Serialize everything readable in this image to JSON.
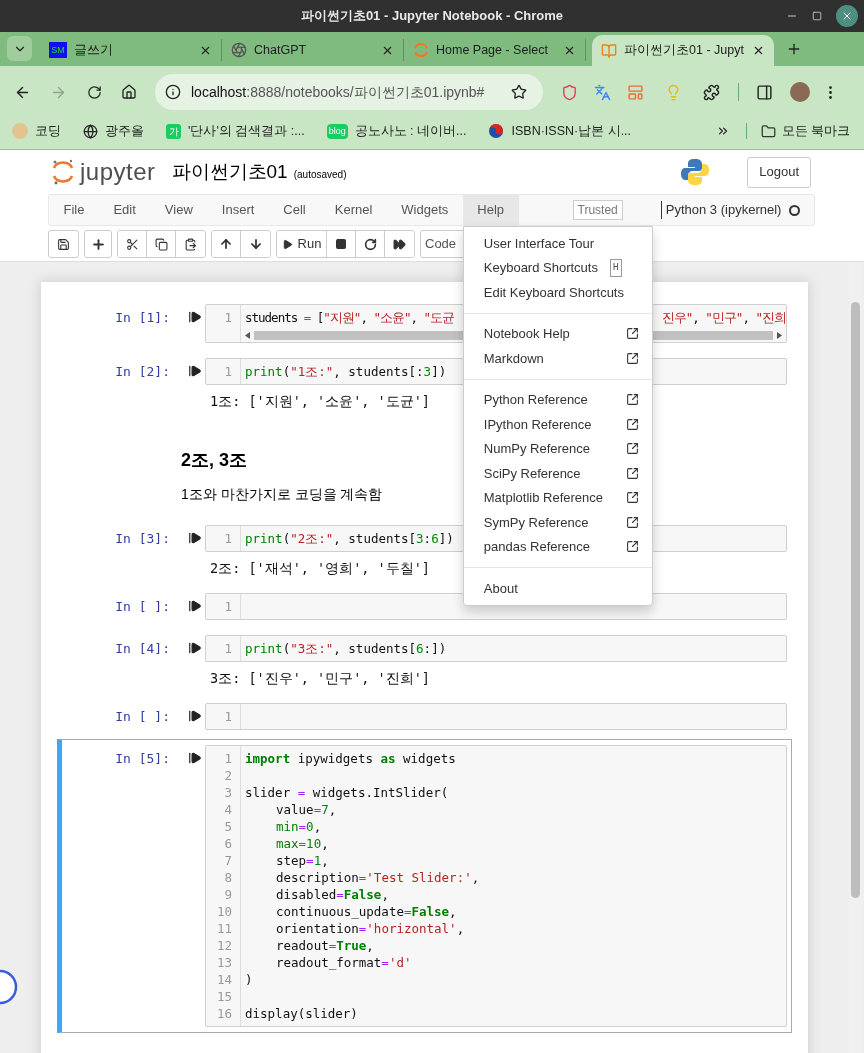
{
  "window": {
    "title": "파이썬기초01 - Jupyter Notebook - Chrome"
  },
  "browser_tabs": [
    {
      "label": "글쓰기",
      "icon_text": "SM",
      "selected": false
    },
    {
      "label": "ChatGPT",
      "selected": false
    },
    {
      "label": "Home Page - Select",
      "selected": false
    },
    {
      "label": "파이썬기초01 - Jupyt",
      "selected": true
    }
  ],
  "address_bar": {
    "host": "localhost",
    "path": ":8888/notebooks/파이썬기초01.ipynb#"
  },
  "bookmarks": [
    {
      "label": "코딩"
    },
    {
      "label": "광주올"
    },
    {
      "label": "'단사'의 검색결과 :...",
      "icon_text": "가"
    },
    {
      "label": "공노사노 : 네이버...",
      "icon_text": "blog"
    },
    {
      "label": "ISBN·ISSN·납본 시..."
    }
  ],
  "bookmarks_folder": "모든 북마크",
  "notebook": {
    "logo_text": "jupyter",
    "title": "파이썬기초01",
    "status": "(autosaved)",
    "logout": "Logout",
    "menu": [
      {
        "label": "File",
        "selected": false
      },
      {
        "label": "Edit",
        "selected": false
      },
      {
        "label": "View",
        "selected": false
      },
      {
        "label": "Insert",
        "selected": false
      },
      {
        "label": "Cell",
        "selected": false
      },
      {
        "label": "Kernel",
        "selected": false
      },
      {
        "label": "Widgets",
        "selected": false
      },
      {
        "label": "Help",
        "selected": true
      }
    ],
    "trusted": "Trusted",
    "kernel": "Python 3 (ipykernel)",
    "run_label": "Run",
    "cell_type": "Code"
  },
  "help_menu": [
    [
      {
        "label": "User Interface Tour",
        "kind": "plain"
      },
      {
        "label": "Keyboard Shortcuts",
        "kind": "shortcut",
        "key": "H"
      },
      {
        "label": "Edit Keyboard Shortcuts",
        "kind": "plain"
      }
    ],
    [
      {
        "label": "Notebook Help",
        "kind": "external"
      },
      {
        "label": "Markdown",
        "kind": "external"
      }
    ],
    [
      {
        "label": "Python Reference",
        "kind": "external"
      },
      {
        "label": "IPython Reference",
        "kind": "external"
      },
      {
        "label": "NumPy Reference",
        "kind": "external"
      },
      {
        "label": "SciPy Reference",
        "kind": "external"
      },
      {
        "label": "Matplotlib Reference",
        "kind": "external"
      },
      {
        "label": "SymPy Reference",
        "kind": "external"
      },
      {
        "label": "pandas Reference",
        "kind": "external"
      }
    ],
    [
      {
        "label": "About",
        "kind": "plain"
      }
    ]
  ],
  "cells": [
    {
      "kind": "code",
      "prompt": "In [1]:",
      "selected": false,
      "lines": [
        {
          "n": "1",
          "tokens": [
            {
              "kind": "plain",
              "text": "students "
            },
            {
              "kind": "operator",
              "text": "="
            },
            {
              "kind": "plain",
              "text": " ["
            },
            {
              "kind": "string",
              "text": "\"지원\""
            },
            {
              "kind": "plain",
              "text": ", "
            },
            {
              "kind": "string",
              "text": "\"소윤\""
            },
            {
              "kind": "plain",
              "text": ", "
            },
            {
              "kind": "string",
              "text": "\"도균"
            },
            {
              "kind": "gap"
            },
            {
              "kind": "string",
              "text": "진우\""
            },
            {
              "kind": "plain",
              "text": ", "
            },
            {
              "kind": "string",
              "text": "\"민구\""
            },
            {
              "kind": "plain",
              "text": ", "
            },
            {
              "kind": "string",
              "text": "\"진희"
            }
          ]
        }
      ]
    },
    {
      "kind": "code",
      "prompt": "In [2]:",
      "selected": false,
      "lines": [
        {
          "n": "1",
          "tokens": [
            {
              "kind": "builtin",
              "text": "print"
            },
            {
              "kind": "plain",
              "text": "("
            },
            {
              "kind": "string",
              "text": "\"1조:\""
            },
            {
              "kind": "plain",
              "text": ", students[:"
            },
            {
              "kind": "number",
              "text": "3"
            },
            {
              "kind": "plain",
              "text": "])"
            }
          ]
        }
      ],
      "output": "1조: ['지원', '소윤', '도균']"
    },
    {
      "kind": "markdown",
      "selected": false,
      "heading": "2조, 3조",
      "text": "1조와 마찬가지로 코딩을 계속함"
    },
    {
      "kind": "code",
      "prompt": "In [3]:",
      "selected": false,
      "lines": [
        {
          "n": "1",
          "tokens": [
            {
              "kind": "builtin",
              "text": "print"
            },
            {
              "kind": "plain",
              "text": "("
            },
            {
              "kind": "string",
              "text": "\"2조:\""
            },
            {
              "kind": "plain",
              "text": ", students["
            },
            {
              "kind": "number",
              "text": "3"
            },
            {
              "kind": "plain",
              "text": ":"
            },
            {
              "kind": "number",
              "text": "6"
            },
            {
              "kind": "plain",
              "text": "])"
            }
          ]
        }
      ],
      "output": "2조: ['재석', '영희', '두칠']"
    },
    {
      "kind": "code",
      "prompt": "In [ ]:",
      "selected": false,
      "lines": [
        {
          "n": "1"
        }
      ]
    },
    {
      "kind": "code",
      "prompt": "In [4]:",
      "selected": false,
      "lines": [
        {
          "n": "1",
          "tokens": [
            {
              "kind": "builtin",
              "text": "print"
            },
            {
              "kind": "plain",
              "text": "("
            },
            {
              "kind": "string",
              "text": "\"3조:\""
            },
            {
              "kind": "plain",
              "text": ", students["
            },
            {
              "kind": "number",
              "text": "6"
            },
            {
              "kind": "plain",
              "text": ":])"
            }
          ]
        }
      ],
      "output": "3조: ['진우', '민구', '진희']"
    },
    {
      "kind": "code",
      "prompt": "In [ ]:",
      "selected": false,
      "lines": [
        {
          "n": "1"
        }
      ]
    },
    {
      "kind": "code",
      "prompt": "In [5]:",
      "selected": true,
      "lines": [
        {
          "n": "1",
          "indented": false,
          "tokens": [
            {
              "kind": "keyword",
              "text": "import"
            },
            {
              "kind": "plain",
              "text": " ipywidgets "
            },
            {
              "kind": "keyword",
              "text": "as"
            },
            {
              "kind": "plain",
              "text": " widgets"
            }
          ]
        },
        {
          "n": "2"
        },
        {
          "n": "3",
          "indented": false,
          "tokens": [
            {
              "kind": "plain",
              "text": "slider "
            },
            {
              "kind": "operator",
              "text": "="
            },
            {
              "kind": "plain",
              "text": " widgets.IntSlider("
            }
          ]
        },
        {
          "n": "4",
          "indented": true,
          "tokens": [
            {
              "kind": "plain",
              "text": "value"
            },
            {
              "kind": "operator",
              "text": "="
            },
            {
              "kind": "number",
              "text": "7"
            },
            {
              "kind": "plain",
              "text": ","
            }
          ]
        },
        {
          "n": "5",
          "indented": true,
          "tokens": [
            {
              "kind": "builtin",
              "text": "min"
            },
            {
              "kind": "operator",
              "text": "="
            },
            {
              "kind": "number",
              "text": "0"
            },
            {
              "kind": "plain",
              "text": ","
            }
          ]
        },
        {
          "n": "6",
          "indented": true,
          "tokens": [
            {
              "kind": "builtin",
              "text": "max"
            },
            {
              "kind": "operator",
              "text": "="
            },
            {
              "kind": "number",
              "text": "10"
            },
            {
              "kind": "plain",
              "text": ","
            }
          ]
        },
        {
          "n": "7",
          "indented": true,
          "tokens": [
            {
              "kind": "plain",
              "text": "step"
            },
            {
              "kind": "operator",
              "text": "="
            },
            {
              "kind": "number",
              "text": "1"
            },
            {
              "kind": "plain",
              "text": ","
            }
          ]
        },
        {
          "n": "8",
          "indented": true,
          "tokens": [
            {
              "kind": "plain",
              "text": "description"
            },
            {
              "kind": "operator",
              "text": "="
            },
            {
              "kind": "string",
              "text": "'Test Slider:'"
            },
            {
              "kind": "plain",
              "text": ","
            }
          ]
        },
        {
          "n": "9",
          "indented": true,
          "tokens": [
            {
              "kind": "plain",
              "text": "disabled"
            },
            {
              "kind": "operator",
              "text": "="
            },
            {
              "kind": "keyword",
              "text": "False"
            },
            {
              "kind": "plain",
              "text": ","
            }
          ]
        },
        {
          "n": "10",
          "indented": true,
          "tokens": [
            {
              "kind": "plain",
              "text": "continuous_update"
            },
            {
              "kind": "operator",
              "text": "="
            },
            {
              "kind": "keyword",
              "text": "False"
            },
            {
              "kind": "plain",
              "text": ","
            }
          ]
        },
        {
          "n": "11",
          "indented": true,
          "tokens": [
            {
              "kind": "plain",
              "text": "orientation"
            },
            {
              "kind": "operator",
              "text": "="
            },
            {
              "kind": "string",
              "text": "'horizontal'"
            },
            {
              "kind": "plain",
              "text": ","
            }
          ]
        },
        {
          "n": "12",
          "indented": true,
          "tokens": [
            {
              "kind": "plain",
              "text": "readout"
            },
            {
              "kind": "operator",
              "text": "="
            },
            {
              "kind": "keyword",
              "text": "True"
            },
            {
              "kind": "plain",
              "text": ","
            }
          ]
        },
        {
          "n": "13",
          "indented": true,
          "tokens": [
            {
              "kind": "plain",
              "text": "readout_format"
            },
            {
              "kind": "operator",
              "text": "="
            },
            {
              "kind": "string",
              "text": "'d'"
            }
          ]
        },
        {
          "n": "14",
          "indented": false,
          "tokens": [
            {
              "kind": "plain",
              "text": ")"
            }
          ]
        },
        {
          "n": "15"
        },
        {
          "n": "16",
          "indented": false,
          "tokens": [
            {
              "kind": "plain",
              "text": "display(slider)"
            }
          ]
        }
      ]
    }
  ]
}
